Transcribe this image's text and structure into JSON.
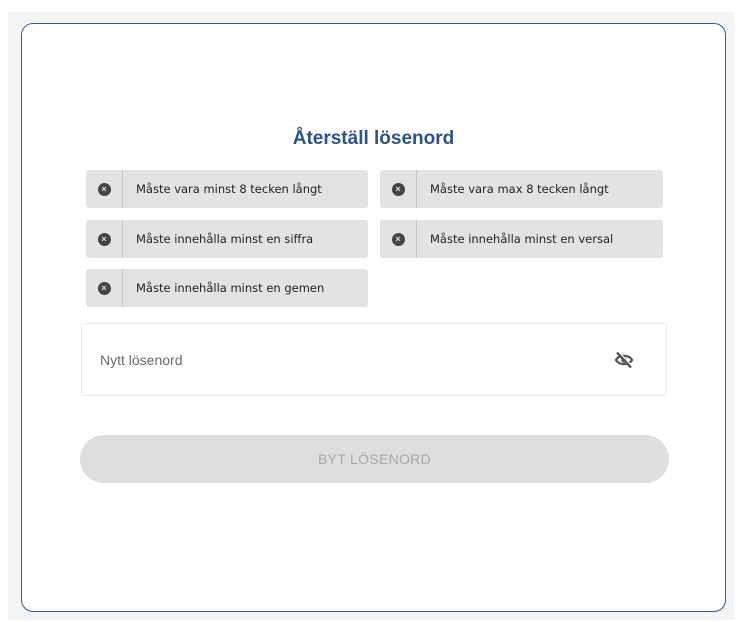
{
  "form": {
    "title": "Återställ lösenord",
    "requirements": [
      {
        "label": "Måste vara minst 8 tecken långt",
        "met": false
      },
      {
        "label": "Måste vara max 8 tecken långt",
        "met": false
      },
      {
        "label": "Måste innehålla minst en siffra",
        "met": false
      },
      {
        "label": "Måste innehålla minst en versal",
        "met": false
      },
      {
        "label": "Måste innehålla minst en gemen",
        "met": false
      }
    ],
    "password_placeholder": "Nytt lösenord",
    "password_value": "",
    "visibility_icon": "eye-slash-icon",
    "submit_label": "BYT LÖSENORD",
    "submit_enabled": false
  },
  "colors": {
    "accent": "#2e5187",
    "card_border": "#3b5b8a",
    "chip_bg": "#e3e3e5",
    "button_disabled_bg": "#dedede",
    "button_disabled_text": "#a8a8a8"
  }
}
